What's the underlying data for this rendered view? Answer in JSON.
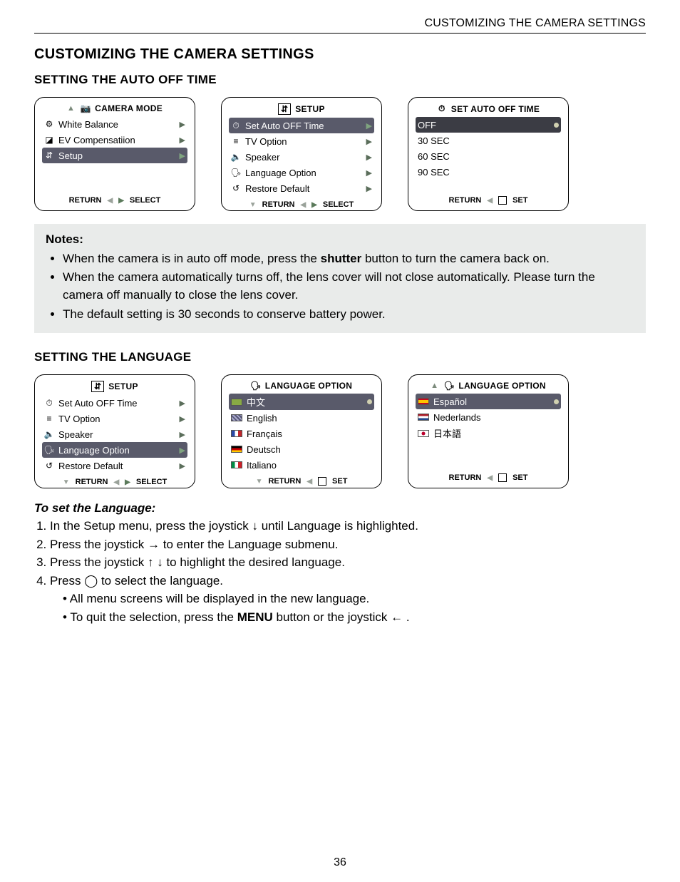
{
  "running_head": "CUSTOMIZING THE CAMERA SETTINGS",
  "section_title": "CUSTOMIZING THE CAMERA SETTINGS",
  "sub_auto_off": "SETTING THE AUTO OFF TIME",
  "sub_language": "SETTING THE LANGUAGE",
  "menu_labels": {
    "camera_mode": "CAMERA  MODE",
    "setup": "SETUP",
    "set_auto_off_time": "SET AUTO OFF TIME",
    "language_option": "LANGUAGE  OPTION",
    "return": "RETURN",
    "select": "SELECT",
    "set": "SET"
  },
  "menu_a1": {
    "items": [
      {
        "icon": "⚙",
        "label": "White Balance",
        "selected": false
      },
      {
        "icon": "◪",
        "label": "EV Compensatiion",
        "selected": false
      },
      {
        "icon": "⇵",
        "label": "Setup",
        "selected": true
      }
    ]
  },
  "menu_a2": {
    "items": [
      {
        "icon": "⏱",
        "label": "Set Auto OFF Time",
        "selected": true
      },
      {
        "icon": "≡",
        "label": "TV Option",
        "selected": false
      },
      {
        "icon": "🔈",
        "label": "Speaker",
        "selected": false
      },
      {
        "icon": "🗣",
        "label": "Language Option",
        "selected": false
      },
      {
        "icon": "↺",
        "label": "Restore Default",
        "selected": false
      }
    ]
  },
  "menu_a3": {
    "items": [
      {
        "label": "OFF",
        "selected": true
      },
      {
        "label": "30 SEC",
        "selected": false
      },
      {
        "label": "60 SEC",
        "selected": false
      },
      {
        "label": "90 SEC",
        "selected": false
      }
    ]
  },
  "menu_b1": {
    "items": [
      {
        "icon": "⏱",
        "label": "Set Auto OFF Time",
        "selected": false
      },
      {
        "icon": "≡",
        "label": "TV Option",
        "selected": false
      },
      {
        "icon": "🔈",
        "label": "Speaker",
        "selected": false
      },
      {
        "icon": "🗣",
        "label": "Language Option",
        "selected": true
      },
      {
        "icon": "↺",
        "label": "Restore Default",
        "selected": false
      }
    ]
  },
  "menu_b2": {
    "items": [
      {
        "flag": "cn",
        "label": "中文",
        "selected": true
      },
      {
        "flag": "uk",
        "label": "English",
        "selected": false
      },
      {
        "flag": "fr",
        "label": "Français",
        "selected": false
      },
      {
        "flag": "de",
        "label": "Deutsch",
        "selected": false
      },
      {
        "flag": "it",
        "label": "Italiano",
        "selected": false
      }
    ]
  },
  "menu_b3": {
    "items": [
      {
        "flag": "es",
        "label": "Español",
        "selected": true
      },
      {
        "flag": "nl",
        "label": "Nederlands",
        "selected": false
      },
      {
        "flag": "jp",
        "label": "日本語",
        "selected": false
      }
    ]
  },
  "notes": {
    "title": "Notes:",
    "lines": [
      {
        "pre": "When the camera is in auto off mode, press the ",
        "bold": "shutter",
        "post": " button to turn the camera back on."
      },
      {
        "pre": "When the camera automatically turns off, the lens cover will not close automatically. Please turn the camera off manually to close the lens cover.",
        "bold": "",
        "post": ""
      },
      {
        "pre": "The default setting is 30 seconds to conserve battery power.",
        "bold": "",
        "post": ""
      }
    ]
  },
  "instr_title": "To set the Language:",
  "instr": {
    "step1_a": "In the Setup menu, press the joystick  ",
    "step1_b": "  until Language is highlighted.",
    "step2_a": "Press the joystick  ",
    "step2_b": "  to enter the Language submenu.",
    "step3_a": "Press the joystick ",
    "step3_b": "   to highlight the desired language.",
    "step4_a": "Press  ",
    "step4_b": "   to select the language.",
    "sub1": "All menu screens will be displayed in the new language.",
    "sub2_a": "To quit the selection, press the ",
    "sub2_bold": "MENU",
    "sub2_b": " button or the joystick  ",
    "sub2_c": "  ."
  },
  "page_number": "36"
}
